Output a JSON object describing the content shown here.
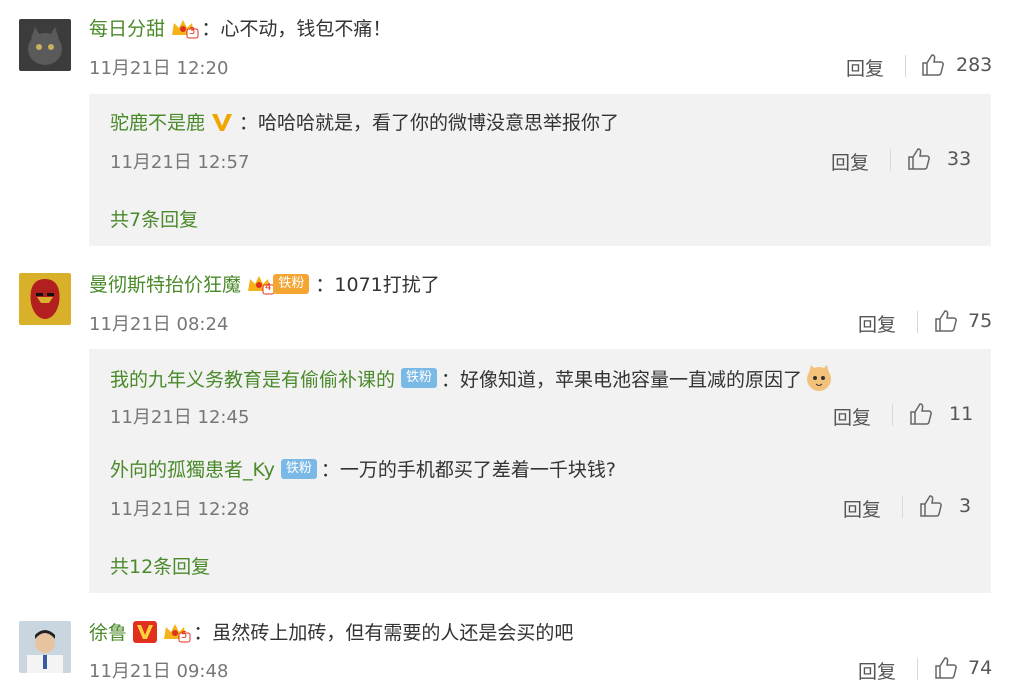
{
  "comments": [
    {
      "username": "每日分甜",
      "vip_level": "3",
      "text": "：心不动，钱包不痛！",
      "time": "11月21日 12:20",
      "reply_label": "回复",
      "likes": "283",
      "replies": [
        {
          "username": "驼鹿不是鹿",
          "text": "：哈哈哈就是，看了你的微博没意思举报你了",
          "time": "11月21日 12:57",
          "reply_label": "回复",
          "likes": "33"
        }
      ],
      "more": "共7条回复"
    },
    {
      "username": "曼彻斯特抬价狂魔",
      "vip_level": "4",
      "fan_badge": "铁粉",
      "text": "：1071打扰了",
      "time": "11月21日 08:24",
      "reply_label": "回复",
      "likes": "75",
      "replies": [
        {
          "username": "我的九年义务教育是有偷偷补课的",
          "fan_badge": "铁粉",
          "text": "：好像知道，苹果电池容量一直减的原因了",
          "time": "11月21日 12:45",
          "reply_label": "回复",
          "likes": "11"
        },
        {
          "username": "外向的孤獨患者_Ky",
          "fan_badge": "铁粉",
          "text": "：一万的手机都买了差着一千块钱?",
          "time": "11月21日 12:28",
          "reply_label": "回复",
          "likes": "3"
        }
      ],
      "more": "共12条回复"
    },
    {
      "username": "徐鲁",
      "vip_level": "5",
      "text": "：虽然砖上加砖，但有需要的人还是会买的吧",
      "time": "11月21日 09:48",
      "reply_label": "回复",
      "likes": "74"
    }
  ],
  "colors": {
    "name": "#4a8a2a",
    "reply_bg": "#f2f2f2",
    "verified_v": "#f0a500",
    "vip_red": "#e0301e"
  }
}
